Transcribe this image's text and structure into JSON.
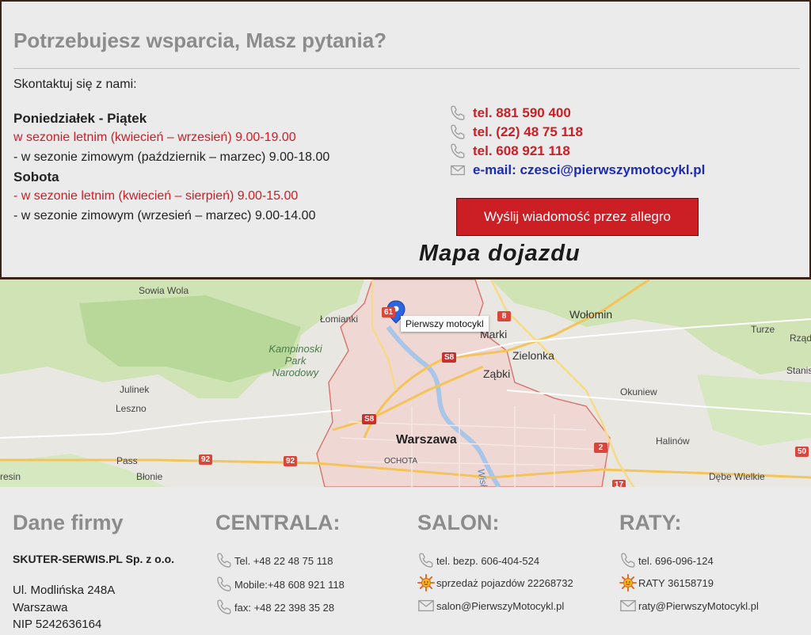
{
  "support": {
    "title": "Potrzebujesz wsparcia, Masz pytania?",
    "contact_intro": "Skontaktuj się z nami:",
    "weekday_label": "Poniedziałek - Piątek",
    "weekday_summer": "w sezonie letnim (kwiecień – wrzesień) 9.00-19.00",
    "weekday_winter": "- w sezonie zimowym (październik – marzec) 9.00-18.00",
    "saturday_label": "Sobota",
    "saturday_summer": "- w sezonie letnim (kwiecień – sierpień) 9.00-15.00",
    "saturday_winter": "- w sezonie zimowym (wrzesień – marzec) 9.00-14.00",
    "phone1": "tel. 881 590 400",
    "phone2": "tel. (22) 48 75 118",
    "phone3": "tel. 608 921 118",
    "email": "e-mail: czesci@pierwszymotocykl.pl",
    "allegro_button": "Wyślij wiadomość przez allegro",
    "map_heading": "Mapa dojazdu",
    "colors": {
      "red": "#cc1f25",
      "blue": "#1b2bb8",
      "heading_gray": "#8c8c8c"
    }
  },
  "map": {
    "pin_label": "Pierwszy motocykl",
    "places": {
      "sowia_wola": "Sowia Wola",
      "lomianki": "Łomianki",
      "marki": "Marki",
      "wolomin": "Wołomin",
      "turze": "Turze",
      "rzad": "Rząd",
      "zielonka": "Zielonka",
      "zabki": "Ząbki",
      "stanis": "Stanis",
      "kampinos": "Kampinoski Park Narodowy",
      "julinek": "Julinek",
      "leszno": "Leszno",
      "okuniew": "Okuniew",
      "warszawa": "Warszawa",
      "halinow": "Halinów",
      "ochota": "OCHOTA",
      "wisla": "Wisła",
      "pass": "Pass",
      "blonie": "Błonie",
      "resin": "resin",
      "debe_wielkie": "Dębe Wielkie"
    },
    "shields": {
      "r8": "8",
      "s8a": "S8",
      "s8b": "S8",
      "r92a": "92",
      "r92b": "92",
      "r2": "2",
      "r50": "50",
      "r17": "17",
      "r61": "61"
    }
  },
  "footer": {
    "company": {
      "heading": "Dane firmy",
      "name": "SKUTER-SERWIS.PL Sp. z o.o.",
      "street": "Ul. Modlińska 248A",
      "city": "Warszawa",
      "nip": "NIP 5242636164"
    },
    "centrala": {
      "heading": "CENTRALA:",
      "tel": "Tel. +48 22 48 75 118",
      "mobile": "Mobile:+48 608 921 118",
      "fax": "fax: +48 22 398 35 28"
    },
    "salon": {
      "heading": "SALON:",
      "tel": "tel. bezp. 606-404-524",
      "sales": "sprzedaż pojazdów 22268732",
      "email": "salon@PierwszyMotocykl.pl"
    },
    "raty": {
      "heading": "RATY:",
      "tel": "tel. 696-096-124",
      "raty": "RATY 36158719",
      "email": "raty@PierwszyMotocykl.pl"
    }
  }
}
